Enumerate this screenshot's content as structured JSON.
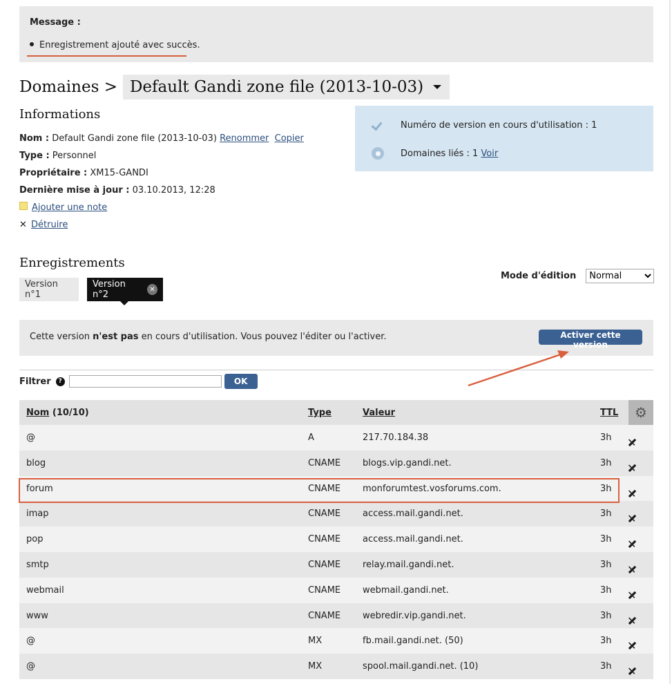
{
  "message": {
    "title": "Message :",
    "item": "Enregistrement ajouté avec succès."
  },
  "header": {
    "breadcrumb": "Domaines >",
    "zone_name": "Default Gandi zone file (2013-10-03)"
  },
  "informations": {
    "heading": "Informations",
    "nom_label": "Nom :",
    "nom_value": "Default Gandi zone file (2013-10-03)",
    "rename_link": "Renommer",
    "copy_link": "Copier",
    "type_label": "Type :",
    "type_value": "Personnel",
    "owner_label": "Propriétaire :",
    "owner_value": "XM15-GANDI",
    "updated_label": "Dernière mise à jour :",
    "updated_value": "03.10.2013, 12:28",
    "add_note_link": "Ajouter une note",
    "destroy_link": "Détruire"
  },
  "status": {
    "version_in_use": "Numéro de version en cours d'utilisation : 1",
    "linked_domains": "Domaines liés : 1",
    "view_link": "Voir"
  },
  "records": {
    "heading": "Enregistrements",
    "mode_label": "Mode d'édition",
    "mode_value": "Normal",
    "tabs": [
      {
        "label": "Version n°1"
      },
      {
        "label": "Version n°2"
      }
    ],
    "notice_prefix": "Cette version",
    "notice_bold": "n'est pas",
    "notice_suffix": "en cours d'utilisation. Vous pouvez l'éditer ou l'activer.",
    "activate_button": "Activer cette version",
    "filter_label": "Filtrer",
    "filter_value": "",
    "ok_button": "OK",
    "columns": {
      "nom": "Nom",
      "count": "(10/10)",
      "type": "Type",
      "valeur": "Valeur",
      "ttl": "TTL"
    },
    "rows": [
      {
        "nom": "@",
        "type": "A",
        "valeur": "217.70.184.38",
        "ttl": "3h"
      },
      {
        "nom": "blog",
        "type": "CNAME",
        "valeur": "blogs.vip.gandi.net.",
        "ttl": "3h"
      },
      {
        "nom": "forum",
        "type": "CNAME",
        "valeur": "monforumtest.vosforums.com.",
        "ttl": "3h"
      },
      {
        "nom": "imap",
        "type": "CNAME",
        "valeur": "access.mail.gandi.net.",
        "ttl": "3h"
      },
      {
        "nom": "pop",
        "type": "CNAME",
        "valeur": "access.mail.gandi.net.",
        "ttl": "3h"
      },
      {
        "nom": "smtp",
        "type": "CNAME",
        "valeur": "relay.mail.gandi.net.",
        "ttl": "3h"
      },
      {
        "nom": "webmail",
        "type": "CNAME",
        "valeur": "webmail.gandi.net.",
        "ttl": "3h"
      },
      {
        "nom": "www",
        "type": "CNAME",
        "valeur": "webredir.vip.gandi.net.",
        "ttl": "3h"
      },
      {
        "nom": "@",
        "type": "MX",
        "valeur": "fb.mail.gandi.net. (50)",
        "ttl": "3h"
      },
      {
        "nom": "@",
        "type": "MX",
        "valeur": "spool.mail.gandi.net. (10)",
        "ttl": "3h"
      }
    ]
  },
  "colors": {
    "accent_button": "#3b6193",
    "annotation": "#d9603f",
    "status_box": "#d5e5f1",
    "link": "#2b4e7e"
  }
}
